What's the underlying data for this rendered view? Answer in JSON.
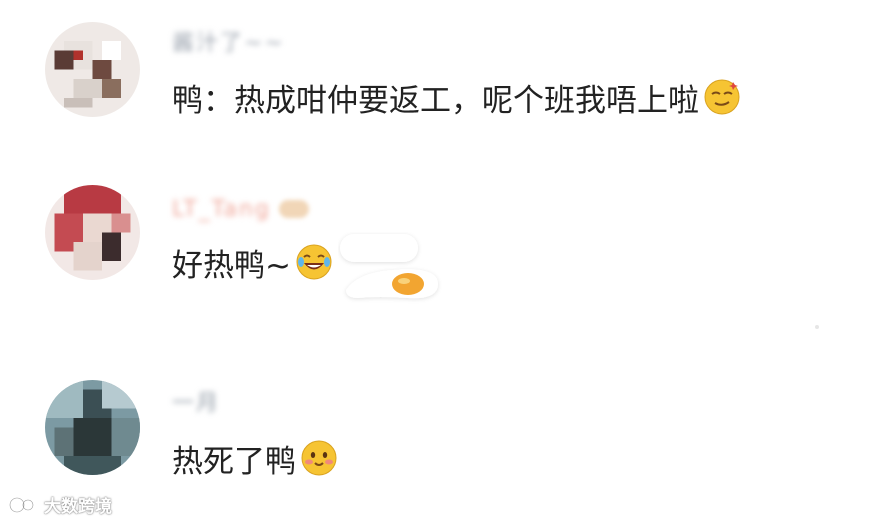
{
  "comments": [
    {
      "username": "酱汁了~~",
      "text": "鸭：热成咁仲要返工，呢个班我唔上啦",
      "emoji": "smirk-sweat-emoji"
    },
    {
      "username": "LT_Tang",
      "text": "好热鸭~",
      "emoji": "laugh-cry-emoji"
    },
    {
      "username": "一月",
      "text": "热死了鸭",
      "emoji": "blush-emoji"
    }
  ],
  "watermark": {
    "text": "大数跨境"
  },
  "colors": {
    "text": "#222222",
    "emoji_yellow": "#f6c433",
    "egg_yolk": "#f2a531"
  }
}
